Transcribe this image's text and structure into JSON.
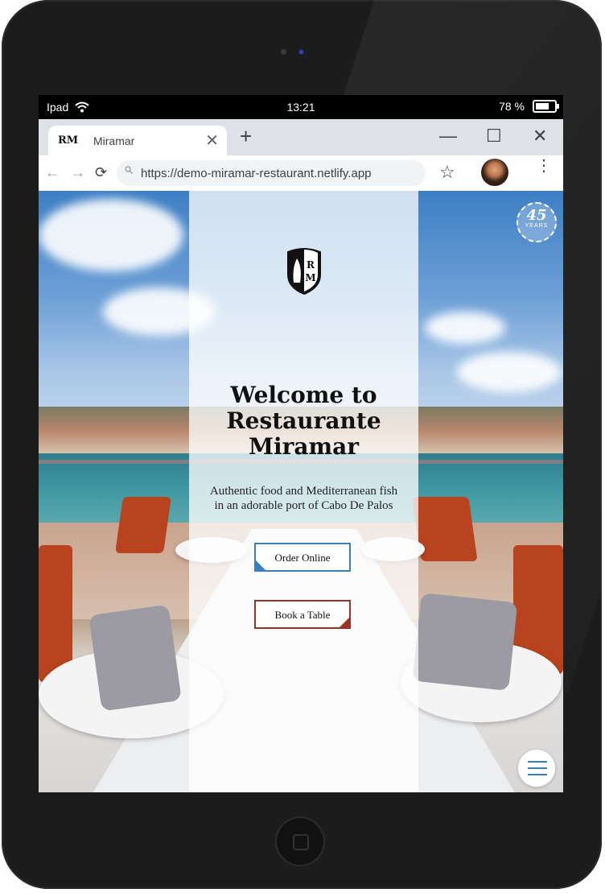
{
  "status_bar": {
    "device_name": "Ipad",
    "time": "13:21",
    "battery": "78 %"
  },
  "browser": {
    "tab": {
      "favicon_text": "RM",
      "title": "Miramar",
      "close_glyph": "✕"
    },
    "new_tab_glyph": "+",
    "window_controls": {
      "minimize": "—",
      "maximize": "☐",
      "close": "✕"
    },
    "nav": {
      "back": "←",
      "forward": "→",
      "reload": "⟳"
    },
    "address": {
      "url": "https://demo-miramar-restaurant.netlify.app"
    },
    "bookmark_glyph": "☆",
    "menu_glyph": "⋮"
  },
  "site": {
    "logo_letters": "RM",
    "badge": {
      "number": "45",
      "label": "YEARS"
    },
    "hero": {
      "title_line1": "Welcome to",
      "title_line2": "Restaurante",
      "title_line3": "Miramar",
      "subtitle_line1": "Authentic food and Mediterranean fish",
      "subtitle_line2": "in an adorable port of Cabo De Palos"
    },
    "buttons": {
      "order_online": "Order Online",
      "book_table": "Book a Table"
    },
    "colors": {
      "accent_blue": "#3b7fbb",
      "accent_red": "#9a3325"
    }
  }
}
